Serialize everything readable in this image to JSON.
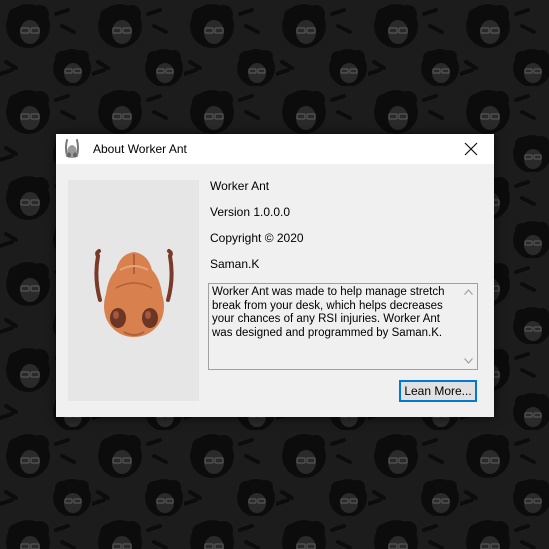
{
  "dialog": {
    "title": "About Worker Ant",
    "app_icon": "worker-ant-icon",
    "close_icon": "close-icon"
  },
  "about": {
    "product_name": "Worker Ant",
    "version": "Version 1.0.0.0",
    "copyright": "Copyright ©  2020",
    "company": "Saman.K",
    "description": "Worker Ant was made to help manage stretch break from your desk, which helps decreases your chances of any RSI injuries. Worker Ant was designed and programmed by Saman.K.",
    "learn_more_label": "Lean More..."
  },
  "colors": {
    "desktop_background": "#1c1c1c",
    "dialog_client": "#f0f0f0",
    "logo_panel": "#e6e6e6",
    "ant_head": "#d8814f",
    "accent_focus": "#0078d7"
  }
}
